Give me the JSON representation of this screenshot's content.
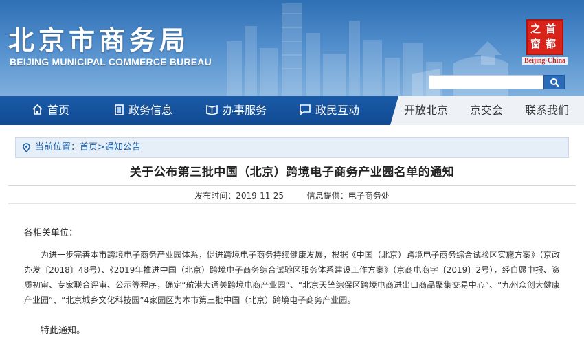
{
  "header": {
    "title_cn": "北京市商务局",
    "title_en": "BEIJING MUNICIPAL COMMERCE BUREAU",
    "logo": {
      "chars": [
        "之",
        "首",
        "窗",
        "都"
      ],
      "caption": "Beijing·China",
      "color": "#d8231a"
    },
    "search": {
      "placeholder": "",
      "value": "",
      "icon": "search-icon"
    }
  },
  "nav": {
    "main": [
      {
        "label": "首页",
        "icon": "home-icon"
      },
      {
        "label": "政务信息",
        "icon": "document-icon"
      },
      {
        "label": "办事服务",
        "icon": "book-icon"
      },
      {
        "label": "政民互动",
        "icon": "chat-icon"
      }
    ],
    "secondary": [
      {
        "label": "开放北京"
      },
      {
        "label": "京交会"
      },
      {
        "label": "联系我们"
      }
    ]
  },
  "breadcrumb": {
    "prefix": "当前位置：",
    "home": "首页",
    "separator": ">",
    "current": "通知公告"
  },
  "article": {
    "title": "关于公布第三批中国（北京）跨境电子商务产业园名单的通知",
    "publish_label": "发布时间：",
    "publish_date": "2019-11-25",
    "source_label": "信息提供：",
    "source": "电子商务处",
    "salutation": "各相关单位：",
    "body": "为进一步完善本市跨境电子商务产业园体系，促进跨境电子商务持续健康发展，根据《中国（北京）跨境电子商务综合试验区实施方案》（京政办发〔2018〕48号）、《2019年推进中国（北京）跨境电子商务综合试验区服务体系建设工作方案》（京商电商字〔2019〕2号），经自愿申报、资质初审、专家联合评审、公示等程序，确定“航港大通关跨境电商产业园”、“北京天竺综保区跨境电商进出口商品聚集交易中心”、“九州众创大健康产业园”、“北京城乡文化科技园”4家园区为本市第三批中国（北京）跨境电子商务产业园。",
    "closing": "特此通知。"
  },
  "colors": {
    "nav_bg": "#114a92",
    "breadcrumb_bg": "#e6eff8",
    "link": "#1b5fae"
  }
}
